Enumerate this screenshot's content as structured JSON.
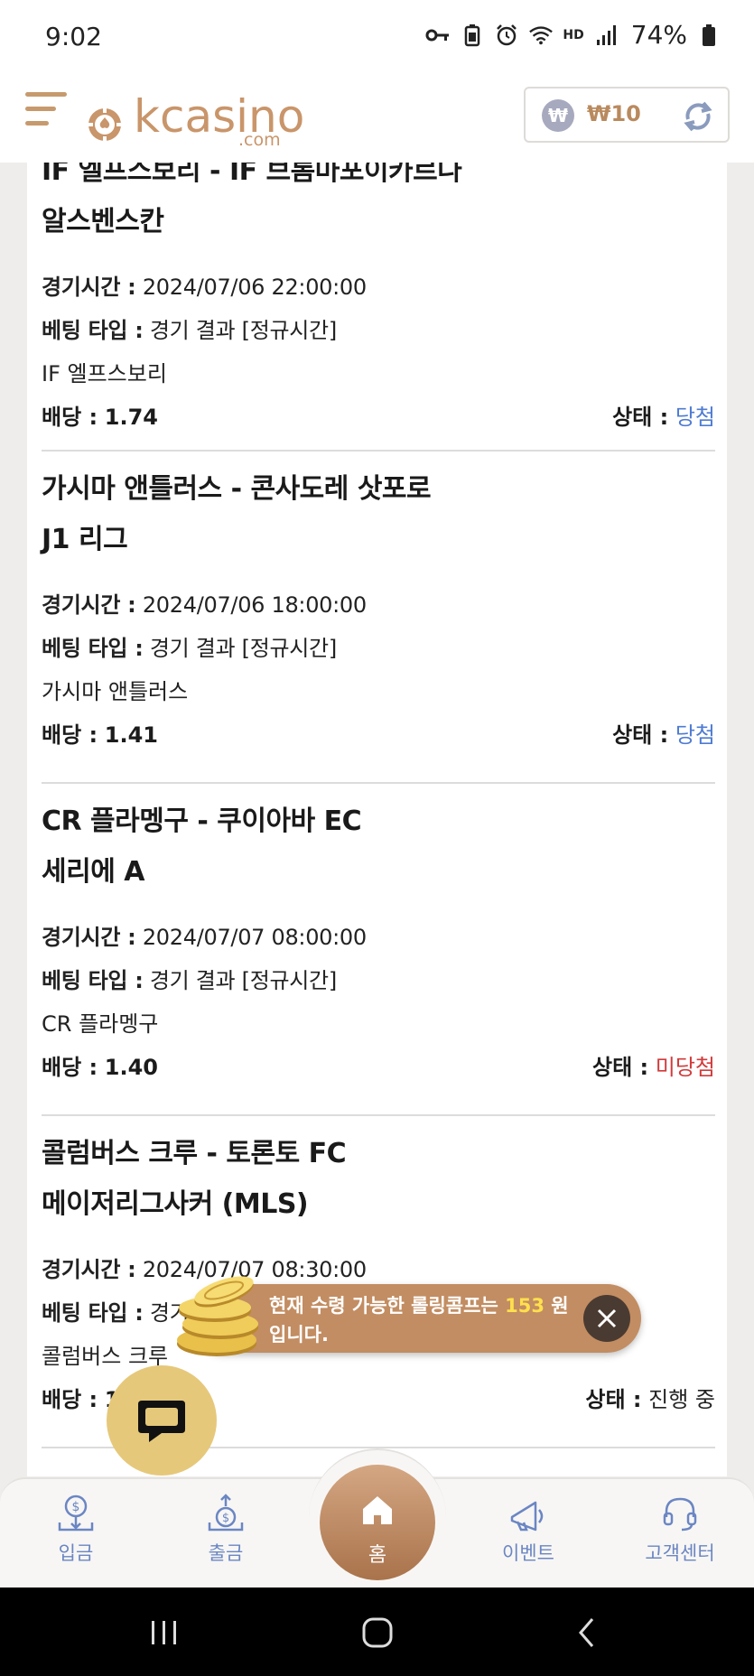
{
  "status_bar": {
    "time": "9:02",
    "hd": "HD",
    "battery": "74%"
  },
  "header": {
    "logo_text": "kcasino",
    "logo_sub": ".com",
    "wallet_symbol": "₩",
    "wallet_amount": "₩10"
  },
  "labels": {
    "time": "경기시간 :",
    "bet_type": "베팅 타입 :",
    "odds": "배당 :",
    "status": "상태 :"
  },
  "bets": [
    {
      "match": "IF 엘프스보리 - IF 브롬마포이카르나",
      "league": "알스벤스칸",
      "time": "2024/07/06 22:00:00",
      "bet_type": "경기 결과 [정규시간]",
      "pick": "IF 엘프스보리",
      "odds": "1.74",
      "status": "당첨"
    },
    {
      "match": "가시마 앤틀러스 - 콘사도레 삿포로",
      "league": "J1 리그",
      "time": "2024/07/06 18:00:00",
      "bet_type": "경기 결과 [정규시간]",
      "pick": "가시마 앤틀러스",
      "odds": "1.41",
      "status": "당첨"
    },
    {
      "match": "CR 플라멩구 - 쿠이아바 EC",
      "league": "세리에 A",
      "time": "2024/07/07 08:00:00",
      "bet_type": "경기 결과 [정규시간]",
      "pick": "CR 플라멩구",
      "odds": "1.40",
      "status": "미당첨"
    },
    {
      "match": "콜럼버스 크루 - 토론토 FC",
      "league": "메이저리그사커 (MLS)",
      "time": "2024/07/07 08:30:00",
      "bet_type": "경기 결과 [정규시간]",
      "pick": "콜럼버스 크루",
      "odds": "1.50",
      "status": "진행 중"
    }
  ],
  "toast": {
    "prefix": "현재 수령 가능한 롤링콤프는 ",
    "amount": "153",
    "suffix": " 원 입니다."
  },
  "nav": {
    "deposit": "입금",
    "withdraw": "출금",
    "home": "홈",
    "event": "이벤트",
    "support": "고객센터"
  },
  "colors": {
    "brand": "#c9956a",
    "win": "#4e7bd3",
    "lose": "#d23a3a",
    "nav_label": "#6b86c3"
  }
}
